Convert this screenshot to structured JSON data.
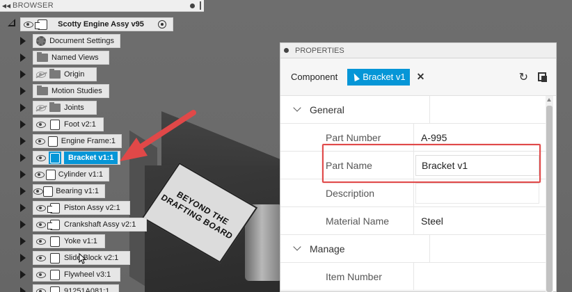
{
  "browser": {
    "title": "BROWSER",
    "root": {
      "label": "Scotty Engine Assy v95"
    },
    "items": [
      {
        "label": "Document Settings",
        "icon": "gear-icon",
        "visible": null
      },
      {
        "label": "Named Views",
        "icon": "folder-icon",
        "visible": null
      },
      {
        "label": "Origin",
        "icon": "folder-icon",
        "visible": false
      },
      {
        "label": "Motion Studies",
        "icon": "folder-icon",
        "visible": null
      },
      {
        "label": "Joints",
        "icon": "folder-icon",
        "visible": false
      },
      {
        "label": "Foot v2:1",
        "icon": "component-icon",
        "visible": true
      },
      {
        "label": "Engine Frame:1",
        "icon": "component-icon",
        "visible": true
      },
      {
        "label": "Bracket v1:1",
        "icon": "component-icon",
        "visible": true,
        "selected": true
      },
      {
        "label": "Cylinder v1:1",
        "icon": "component-icon",
        "visible": true
      },
      {
        "label": "Bearing v1:1",
        "icon": "component-icon",
        "visible": true
      },
      {
        "label": "Piston Assy v2:1",
        "icon": "assembly-icon",
        "visible": true
      },
      {
        "label": "Crankshaft Assy v2:1",
        "icon": "assembly-icon",
        "visible": true
      },
      {
        "label": "Yoke v1:1",
        "icon": "component-icon",
        "visible": true
      },
      {
        "label": "Slide Block v2:1",
        "icon": "component-icon",
        "visible": true
      },
      {
        "label": "Flywheel v3:1",
        "icon": "component-icon",
        "visible": true
      },
      {
        "label": "91251A081:1",
        "icon": "component-icon",
        "visible": true
      }
    ]
  },
  "model": {
    "plate_line1": "BEYOND THE",
    "plate_line2": "DRAFTING BOARD"
  },
  "properties": {
    "title": "PROPERTIES",
    "scope_label": "Component",
    "selected_chip": "Bracket v1",
    "sections": {
      "general": "General",
      "manage": "Manage"
    },
    "rows": {
      "part_number": {
        "label": "Part Number",
        "value": "A-995"
      },
      "part_name": {
        "label": "Part Name",
        "value": "Bracket v1"
      },
      "description": {
        "label": "Description",
        "value": ""
      },
      "material_name": {
        "label": "Material Name",
        "value": "Steel"
      },
      "item_number": {
        "label": "Item Number",
        "value": ""
      }
    }
  },
  "colors": {
    "accent": "#0696d7",
    "annotation_red": "#e04848",
    "viewport": "#6e6e6e"
  }
}
